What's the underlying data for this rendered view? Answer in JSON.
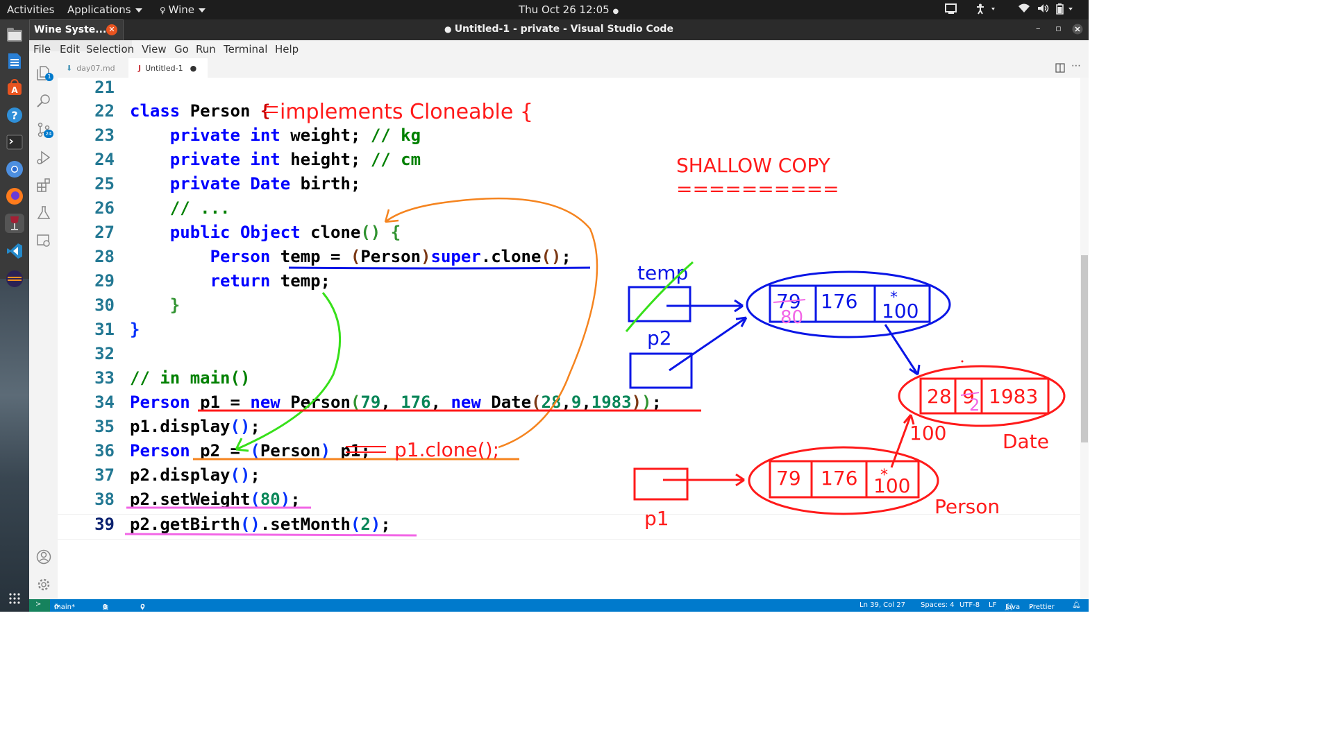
{
  "topbar": {
    "activities": "Activities",
    "applications": "Applications",
    "wine": "Wine",
    "clock": "Thu Oct 26  12:05"
  },
  "window": {
    "title": "Untitled-1 - private - Visual Studio Code",
    "popup": "Wine Syste..."
  },
  "menu": [
    "File",
    "Edit",
    "Selection",
    "View",
    "Go",
    "Run",
    "Terminal",
    "Help"
  ],
  "tabs": [
    {
      "label": "day07.md"
    },
    {
      "label": "Untitled-1"
    }
  ],
  "activity_badges": {
    "explorer": "1",
    "scm": "24"
  },
  "code": {
    "line_numbers": [
      "21",
      "22",
      "23",
      "24",
      "25",
      "26",
      "27",
      "28",
      "29",
      "30",
      "31",
      "32",
      "33",
      "34",
      "35",
      "36",
      "37",
      "38",
      "39"
    ]
  },
  "annotations": {
    "implements": "implements Cloneable {",
    "shallow": "SHALLOW COPY",
    "underline": "==========",
    "clone_call": "p1.clone();",
    "temp": "temp",
    "p2": "p2",
    "p1": "p1",
    "blue_obj": [
      "79",
      "176",
      "100"
    ],
    "blue_new_weight": "80",
    "red_obj": [
      "79",
      "176",
      "100"
    ],
    "date_obj": [
      "28",
      "9",
      "1983"
    ],
    "date_new_month": "2",
    "ref_100": "100",
    "date_label": "Date",
    "person_label": "Person"
  },
  "status": {
    "branch": "main*",
    "errors": "0",
    "warnings": "0",
    "ports": "0",
    "position": "Ln 39, Col 27",
    "spaces": "Spaces: 4",
    "encoding": "UTF-8",
    "eol": "LF",
    "language": "Java",
    "prettier": "Prettier"
  },
  "colors": {
    "ink_red": "#ff1a1a",
    "ink_blue": "#0a16e6",
    "ink_orange": "#f5841f",
    "ink_green": "#37e01a",
    "ink_pink": "#f266e6"
  }
}
